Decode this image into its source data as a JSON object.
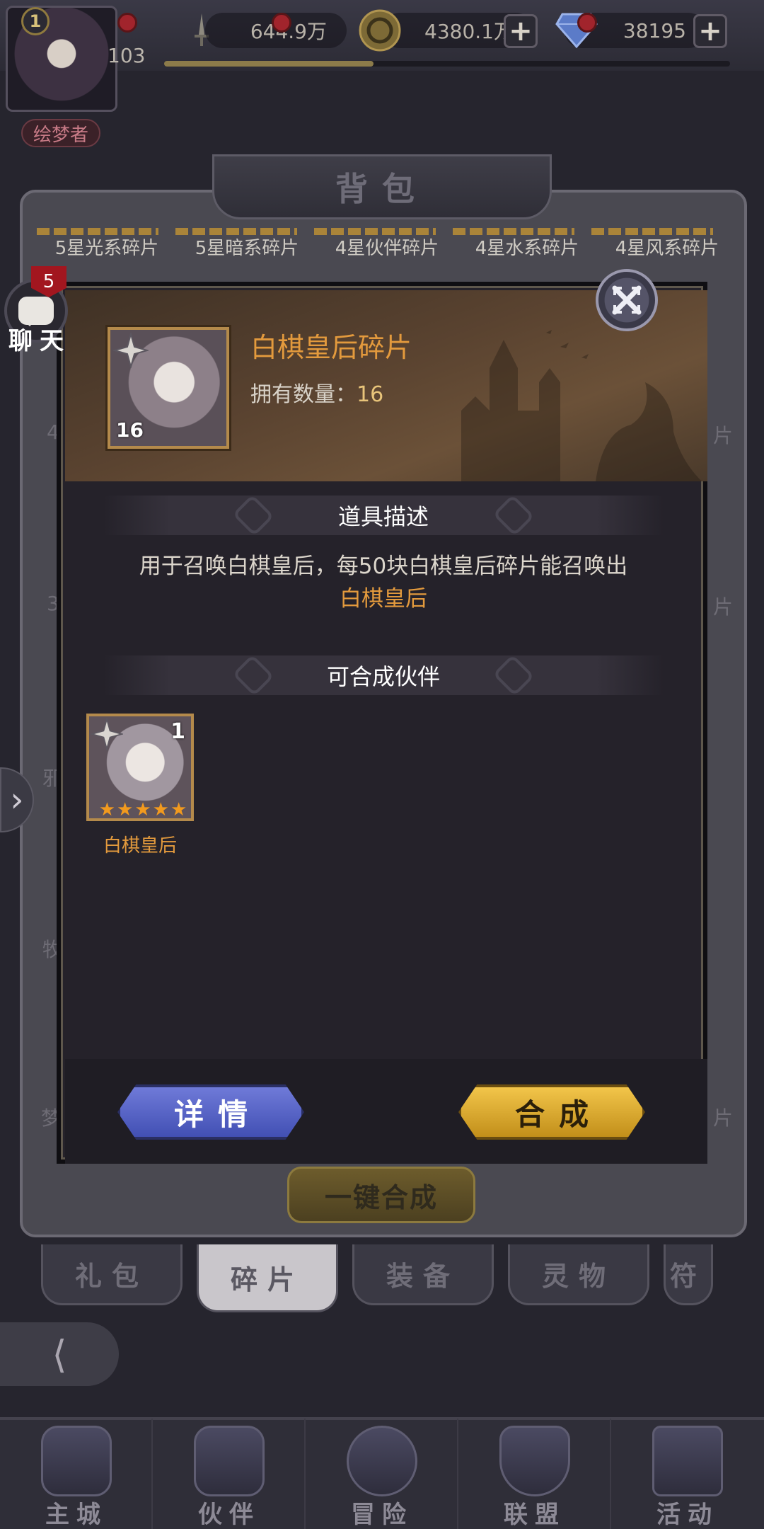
{
  "player": {
    "level": "1",
    "power": "103",
    "title": "绘梦者",
    "exp_fraction": 0.37
  },
  "resources": {
    "power_value": "644.9万",
    "gold_value": "4380.1万",
    "gem_value": "38195",
    "plus_label": "+"
  },
  "bag": {
    "title": "背包",
    "fragment_labels": [
      "5星光系碎片",
      "5星暗系碎片",
      "4星伙伴碎片",
      "4星水系碎片",
      "4星风系碎片"
    ],
    "one_key_label": "一键合成",
    "side_labels_left": [
      "4",
      "3",
      "邪",
      "牧",
      "梦"
    ],
    "side_labels_right": [
      "片",
      "片",
      "片"
    ]
  },
  "categories": {
    "tabs": [
      "礼包",
      "碎片",
      "装备",
      "灵物",
      "符"
    ],
    "active": "碎片"
  },
  "chat": {
    "label": "聊天",
    "count": "5"
  },
  "modal": {
    "item_name": "白棋皇后碎片",
    "item_count": "16",
    "owned_label": "拥有数量：",
    "owned_value": "16",
    "desc_section_title": "道具描述",
    "desc_text": "用于召唤白棋皇后，每50块白棋皇后碎片能召唤出",
    "desc_highlight": "白棋皇后",
    "partner_section_title": "可合成伙伴",
    "partner_name": "白棋皇后",
    "partner_level": "1",
    "partner_stars": 5,
    "detail_label": "详情",
    "compose_label": "合成"
  },
  "nav": {
    "items": [
      "主城",
      "伙伴",
      "冒险",
      "联盟",
      "活动"
    ]
  },
  "colors": {
    "accent_orange": "#e39a3d",
    "gold_button": "#f2c54a",
    "blue_button": "#5563c6",
    "notification_red": "#a1242c"
  }
}
